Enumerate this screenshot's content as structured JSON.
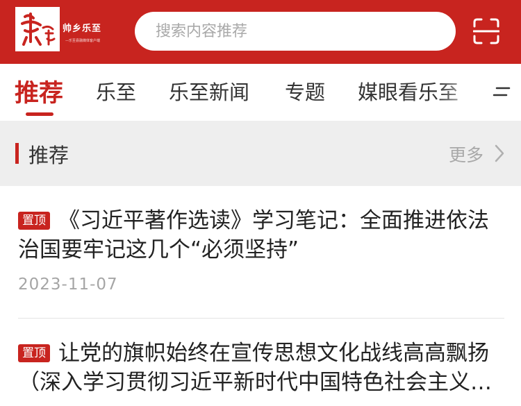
{
  "header": {
    "logo_mark": "樂至",
    "logo_text": "帅乡乐至",
    "logo_subtitle": "—乐至县融媒体客户端",
    "brand_color": "#c8241f"
  },
  "search": {
    "placeholder": "搜索内容推荐",
    "value": "",
    "scan_icon": "scan-icon"
  },
  "tabs": [
    {
      "label": "推荐",
      "active": true
    },
    {
      "label": "乐至",
      "active": false
    },
    {
      "label": "乐至新闻",
      "active": false
    },
    {
      "label": "专题",
      "active": false
    },
    {
      "label": "媒眼看乐至",
      "active": false
    }
  ],
  "tabs_menu_icon": "menu-icon",
  "section": {
    "title": "推荐",
    "more_label": "更多"
  },
  "articles": [
    {
      "badge": "置顶",
      "title": "《习近平著作选读》学习笔记：全面推进依法治国要牢记这几个“必须坚持”",
      "date": "2023-11-07"
    },
    {
      "badge": "置顶",
      "title": "让党的旗帜始终在宣传思想文化战线高高飘扬（深入学习贯彻习近平新时代中国特色社会主义思想"
    }
  ]
}
